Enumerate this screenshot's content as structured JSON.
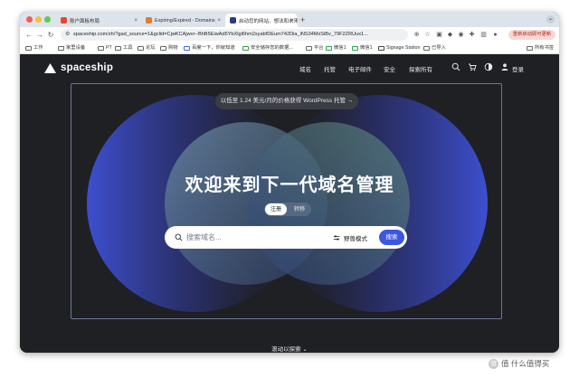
{
  "colors": {
    "accent": "#3b56e0",
    "page_bg": "#1f2024",
    "update_btn_bg": "#f7d8d4",
    "update_btn_text": "#b3261e"
  },
  "browser": {
    "tabs": [
      {
        "title": "账户面板布局",
        "favicon_color": "#e0482f"
      },
      {
        "title": "Expiring/Expired - Domains",
        "favicon_color": "#e07b2f"
      },
      {
        "title": "启动您的网站、想法和未来",
        "favicon_color": "#2b3a8c"
      }
    ],
    "tab_close_glyph": "×",
    "new_tab_glyph": "+",
    "url": "spaceship.com/zh/?gad_source=1&gclid=CjwKCAjwvr--BhB5EiwAd5YbXlgl6hm2syabfDEum742Dia_iNS34MxSiBv_79F2ZRUux1...",
    "update_button": "重新启动即可更新",
    "bookmarks": [
      "工作",
      "家里设备",
      "PT",
      "工具",
      "论坛",
      "购物",
      "百度一下，你就知道",
      "安全储存您的数据...",
      "平台",
      "微信1",
      "微信1",
      "Signage Station",
      "已导入"
    ],
    "all_bookmarks": "所有书签"
  },
  "site": {
    "logo_text": "spaceship",
    "nav": [
      "域名",
      "托管",
      "电子邮件",
      "安全",
      "探索所有"
    ],
    "login": "登录",
    "promo": "以低至 1.24 美元/月的价格获得 WordPress 托管 →",
    "headline": "欢迎来到下一代域名管理",
    "toggle": {
      "register": "注册",
      "transfer": "转移"
    },
    "search": {
      "placeholder": "搜索域名...",
      "pro_mode": "野兽模式",
      "button": "搜索"
    },
    "scroll_hint": "滚动以探索 ⌄"
  },
  "watermark": "值 什么值得买"
}
